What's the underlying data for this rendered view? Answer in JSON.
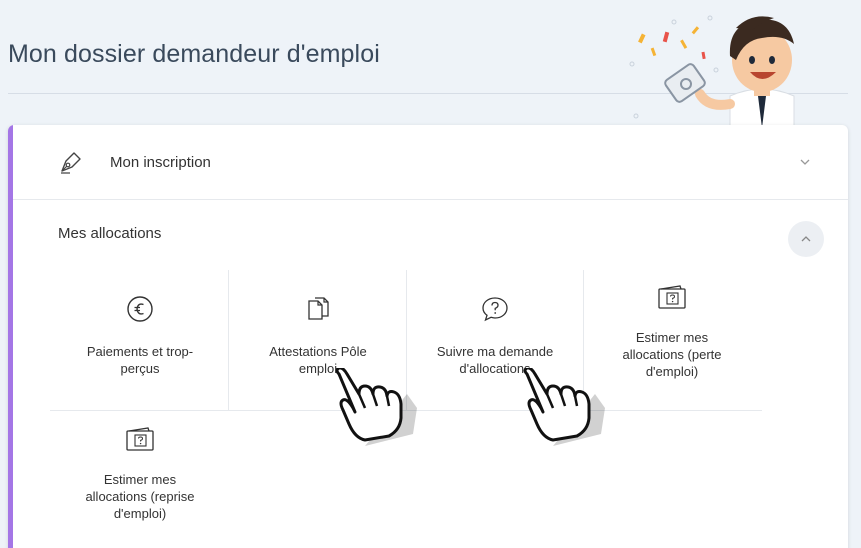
{
  "header": {
    "title": "Mon dossier demandeur d'emploi"
  },
  "sections": {
    "inscription": {
      "label": "Mon inscription"
    },
    "allocations": {
      "label": "Mes allocations"
    }
  },
  "tiles": [
    {
      "label_lines": [
        "Paiements et trop-",
        "perçus"
      ],
      "icon": "euro-circle-icon"
    },
    {
      "label_lines": [
        "Attestations Pôle",
        "emploi"
      ],
      "icon": "documents-icon"
    },
    {
      "label_lines": [
        "Suivre ma demande",
        "d'allocations"
      ],
      "icon": "speech-bubble-question-icon"
    },
    {
      "label_lines": [
        "Estimer mes",
        "allocations (perte",
        "d'emploi)"
      ],
      "icon": "wallet-question-icon"
    },
    {
      "label_lines": [
        "Estimer mes",
        "allocations (reprise",
        "d'emploi)"
      ],
      "icon": "wallet-question-icon"
    }
  ],
  "colors": {
    "accent": "#a476e6",
    "background": "#eef3f8",
    "title": "#3a4a5c"
  }
}
